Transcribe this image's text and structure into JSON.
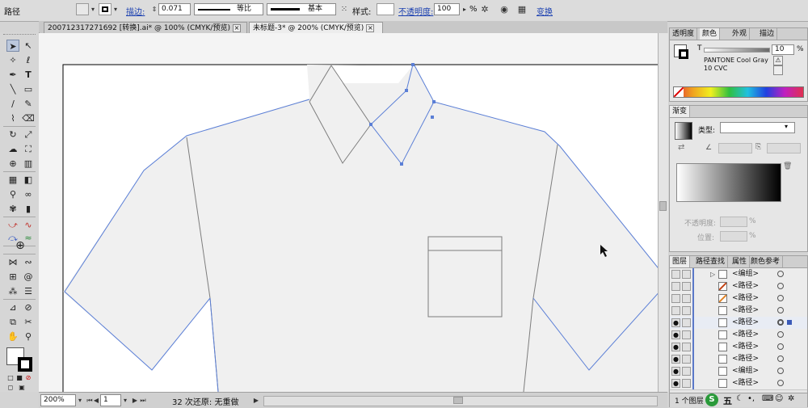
{
  "control_bar": {
    "selection_label": "路径",
    "stroke_label": "描边:",
    "stroke_weight": "0.071",
    "stroke_profile_label": "等比",
    "brush_label": "基本",
    "style_label": "样式:",
    "opacity_label": "不透明度:",
    "opacity_value": "100",
    "opacity_unit": "%",
    "transform_label": "变换"
  },
  "document_tabs": [
    {
      "label": "20071231727169​2 [转换].ai* @ 100% (CMYK/预览)"
    },
    {
      "label": "未标题-3* @ 200% (CMYK/预览)"
    }
  ],
  "status_bar": {
    "zoom": "200%",
    "artboard": "1",
    "info": "32 次还原: 无重做"
  },
  "color_panel": {
    "tabs": [
      "透明度",
      "颜色",
      "外观",
      "描边"
    ],
    "tint_label": "T",
    "tint_value": "10",
    "tint_unit": "%",
    "swatch_name_line1": "PANTONE Cool Gray",
    "swatch_name_line2": "10 CVC"
  },
  "gradient_panel": {
    "title": "渐变",
    "type_label": "类型:",
    "opacity_label": "不透明度:",
    "opacity_unit": "%",
    "position_label": "位置:",
    "position_unit": "%"
  },
  "layers_panel": {
    "tabs": [
      "图层",
      "路径查找",
      "属性",
      "颜色参考"
    ],
    "rows": [
      {
        "name": "<编组>"
      },
      {
        "name": "<路径>"
      },
      {
        "name": "<路径>"
      },
      {
        "name": "<路径>"
      },
      {
        "name": "<路径>"
      },
      {
        "name": "<路径>"
      },
      {
        "name": "<路径>"
      },
      {
        "name": "<路径>"
      },
      {
        "name": "<编组>"
      },
      {
        "name": "<路径>"
      }
    ],
    "footer": "1 个图层"
  },
  "taskbar": {
    "ime_label": "五"
  }
}
